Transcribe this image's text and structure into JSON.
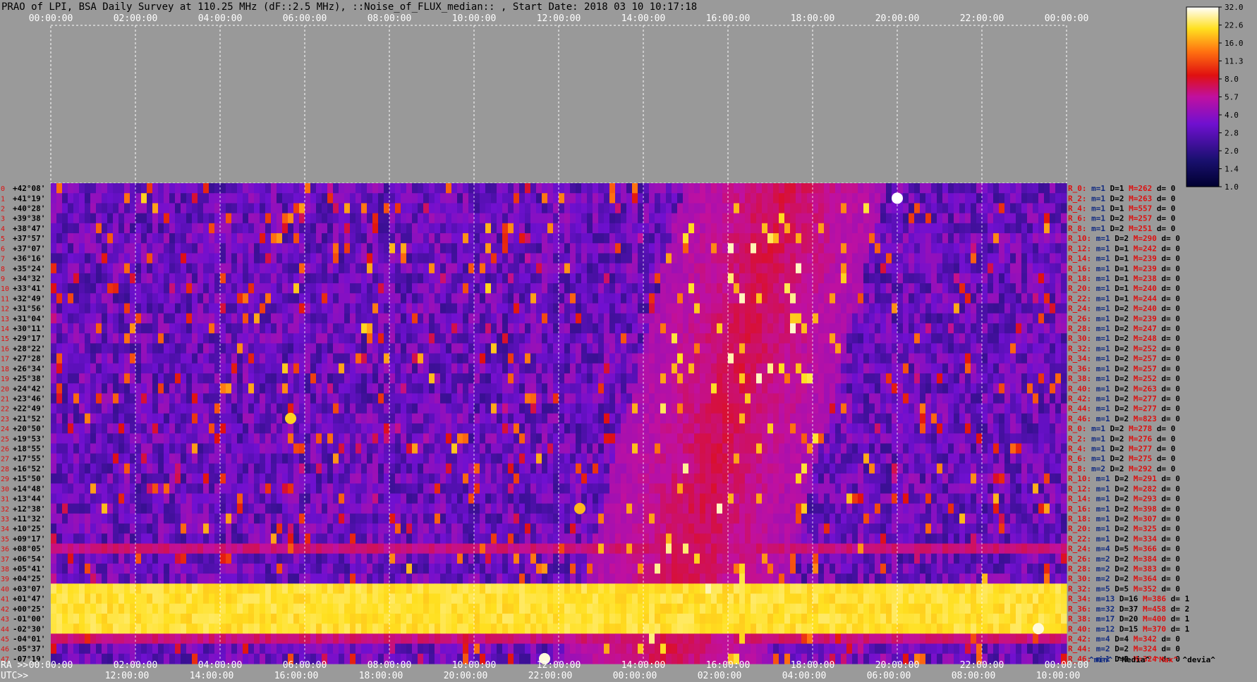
{
  "title": "PRAO of LPI, BSA Daily Survey at 110.25 MHz (dF::2.5 MHz), ::Noise_of_FLUX_median:: , Start Date: 2018 03 10 10:17:18",
  "colors": {
    "background": "#9a9a9a",
    "grid": "#ffffff",
    "label_red": "#dd1111",
    "label_blue": "#102a80",
    "text": "#000000"
  },
  "top_time_ticks": [
    "00:00:00",
    "02:00:00",
    "04:00:00",
    "06:00:00",
    "08:00:00",
    "10:00:00",
    "12:00:00",
    "14:00:00",
    "16:00:00",
    "18:00:00",
    "20:00:00",
    "22:00:00",
    "00:00:00"
  ],
  "ra_axis_label": "RA >>",
  "ra_ticks": [
    "00:00:00",
    "02:00:00",
    "04:00:00",
    "06:00:00",
    "08:00:00",
    "10:00:00",
    "12:00:00",
    "14:00:00",
    "16:00:00",
    "18:00:00",
    "20:00:00",
    "22:00:00",
    "00:00:00"
  ],
  "utc_axis_label": "UTC>>",
  "utc_ticks": [
    "12:00:00",
    "14:00:00",
    "16:00:00",
    "18:00:00",
    "20:00:00",
    "22:00:00",
    "00:00:00",
    "02:00:00",
    "04:00:00",
    "06:00:00",
    "08:00:00",
    "10:00:00"
  ],
  "declinations": [
    "+42°08'",
    "+41°19'",
    "+40°28'",
    "+39°38'",
    "+38°47'",
    "+37°57'",
    "+37°07'",
    "+36°16'",
    "+35°24'",
    "+34°32'",
    "+33°41'",
    "+32°49'",
    "+31°56'",
    "+31°04'",
    "+30°11'",
    "+29°17'",
    "+28°22'",
    "+27°28'",
    "+26°34'",
    "+25°38'",
    "+24°42'",
    "+23°46'",
    "+22°49'",
    "+21°52'",
    "+20°50'",
    "+19°53'",
    "+18°55'",
    "+17°55'",
    "+16°52'",
    "+15°50'",
    "+14°48'",
    "+13°44'",
    "+12°38'",
    "+11°32'",
    "+10°25'",
    "+09°17'",
    "+08°05'",
    "+06°54'",
    "+05°41'",
    "+04°25'",
    "+03°07'",
    "+01°47'",
    "+00°25'",
    "-01°00'",
    "-02°30'",
    "-04°01'",
    "-05°37'",
    "-07°19'"
  ],
  "beam_stats": [
    {
      "r": "R_0:",
      "m": "m=1",
      "d": "D=1",
      "M": "M=262",
      "dv": "d= 0"
    },
    {
      "r": "R_2:",
      "m": "m=1",
      "d": "D=2",
      "M": "M=263",
      "dv": "d= 0"
    },
    {
      "r": "R_4:",
      "m": "m=1",
      "d": "D=1",
      "M": "M=557",
      "dv": "d= 0"
    },
    {
      "r": "R_6:",
      "m": "m=1",
      "d": "D=2",
      "M": "M=257",
      "dv": "d= 0"
    },
    {
      "r": "R_8:",
      "m": "m=1",
      "d": "D=2",
      "M": "M=251",
      "dv": "d= 0"
    },
    {
      "r": "R_10:",
      "m": "m=1",
      "d": "D=2",
      "M": "M=290",
      "dv": "d= 0"
    },
    {
      "r": "R_12:",
      "m": "m=1",
      "d": "D=1",
      "M": "M=242",
      "dv": "d= 0"
    },
    {
      "r": "R_14:",
      "m": "m=1",
      "d": "D=1",
      "M": "M=239",
      "dv": "d= 0"
    },
    {
      "r": "R_16:",
      "m": "m=1",
      "d": "D=1",
      "M": "M=239",
      "dv": "d= 0"
    },
    {
      "r": "R_18:",
      "m": "m=1",
      "d": "D=1",
      "M": "M=238",
      "dv": "d= 0"
    },
    {
      "r": "R_20:",
      "m": "m=1",
      "d": "D=1",
      "M": "M=240",
      "dv": "d= 0"
    },
    {
      "r": "R_22:",
      "m": "m=1",
      "d": "D=1",
      "M": "M=244",
      "dv": "d= 0"
    },
    {
      "r": "R_24:",
      "m": "m=1",
      "d": "D=2",
      "M": "M=240",
      "dv": "d= 0"
    },
    {
      "r": "R_26:",
      "m": "m=1",
      "d": "D=2",
      "M": "M=239",
      "dv": "d= 0"
    },
    {
      "r": "R_28:",
      "m": "m=1",
      "d": "D=2",
      "M": "M=247",
      "dv": "d= 0"
    },
    {
      "r": "R_30:",
      "m": "m=1",
      "d": "D=2",
      "M": "M=248",
      "dv": "d= 0"
    },
    {
      "r": "R_32:",
      "m": "m=1",
      "d": "D=2",
      "M": "M=252",
      "dv": "d= 0"
    },
    {
      "r": "R_34:",
      "m": "m=1",
      "d": "D=2",
      "M": "M=257",
      "dv": "d= 0"
    },
    {
      "r": "R_36:",
      "m": "m=1",
      "d": "D=2",
      "M": "M=257",
      "dv": "d= 0"
    },
    {
      "r": "R_38:",
      "m": "m=1",
      "d": "D=2",
      "M": "M=252",
      "dv": "d= 0"
    },
    {
      "r": "R_40:",
      "m": "m=1",
      "d": "D=2",
      "M": "M=263",
      "dv": "d= 0"
    },
    {
      "r": "R_42:",
      "m": "m=1",
      "d": "D=2",
      "M": "M=277",
      "dv": "d= 0"
    },
    {
      "r": "R_44:",
      "m": "m=1",
      "d": "D=2",
      "M": "M=277",
      "dv": "d= 0"
    },
    {
      "r": "R_46:",
      "m": "m=1",
      "d": "D=2",
      "M": "M=823",
      "dv": "d= 0"
    },
    {
      "r": "R_0:",
      "m": "m=1",
      "d": "D=2",
      "M": "M=278",
      "dv": "d= 0"
    },
    {
      "r": "R_2:",
      "m": "m=1",
      "d": "D=2",
      "M": "M=276",
      "dv": "d= 0"
    },
    {
      "r": "R_4:",
      "m": "m=1",
      "d": "D=2",
      "M": "M=277",
      "dv": "d= 0"
    },
    {
      "r": "R_6:",
      "m": "m=1",
      "d": "D=2",
      "M": "M=275",
      "dv": "d= 0"
    },
    {
      "r": "R_8:",
      "m": "m=2",
      "d": "D=2",
      "M": "M=292",
      "dv": "d= 0"
    },
    {
      "r": "R_10:",
      "m": "m=1",
      "d": "D=2",
      "M": "M=291",
      "dv": "d= 0"
    },
    {
      "r": "R_12:",
      "m": "m=1",
      "d": "D=2",
      "M": "M=282",
      "dv": "d= 0"
    },
    {
      "r": "R_14:",
      "m": "m=1",
      "d": "D=2",
      "M": "M=293",
      "dv": "d= 0"
    },
    {
      "r": "R_16:",
      "m": "m=1",
      "d": "D=2",
      "M": "M=398",
      "dv": "d= 0"
    },
    {
      "r": "R_18:",
      "m": "m=1",
      "d": "D=2",
      "M": "M=307",
      "dv": "d= 0"
    },
    {
      "r": "R_20:",
      "m": "m=1",
      "d": "D=2",
      "M": "M=325",
      "dv": "d= 0"
    },
    {
      "r": "R_22:",
      "m": "m=1",
      "d": "D=2",
      "M": "M=334",
      "dv": "d= 0"
    },
    {
      "r": "R_24:",
      "m": "m=4",
      "d": "D=5",
      "M": "M=366",
      "dv": "d= 0"
    },
    {
      "r": "R_26:",
      "m": "m=2",
      "d": "D=2",
      "M": "M=384",
      "dv": "d= 0"
    },
    {
      "r": "R_28:",
      "m": "m=2",
      "d": "D=2",
      "M": "M=383",
      "dv": "d= 0"
    },
    {
      "r": "R_30:",
      "m": "m=2",
      "d": "D=2",
      "M": "M=364",
      "dv": "d= 0"
    },
    {
      "r": "R_32:",
      "m": "m=5",
      "d": "D=5",
      "M": "M=352",
      "dv": "d= 0"
    },
    {
      "r": "R_34:",
      "m": "m=13",
      "d": "D=16",
      "M": "M=386",
      "dv": "d= 1"
    },
    {
      "r": "R_36:",
      "m": "m=32",
      "d": "D=37",
      "M": "M=458",
      "dv": "d= 2"
    },
    {
      "r": "R_38:",
      "m": "m=17",
      "d": "D=20",
      "M": "M=400",
      "dv": "d= 1"
    },
    {
      "r": "R_40:",
      "m": "m=12",
      "d": "D=15",
      "M": "M=370",
      "dv": "d= 1"
    },
    {
      "r": "R_42:",
      "m": "m=4",
      "d": "D=4",
      "M": "M=342",
      "dv": "d= 0"
    },
    {
      "r": "R_44:",
      "m": "m=2",
      "d": "D=2",
      "M": "M=324",
      "dv": "d= 0"
    },
    {
      "r": "R_46:",
      "m": "m=1",
      "d": "D=2",
      "M": "M=324",
      "dv": "d= 0"
    }
  ],
  "stats_legend": {
    "min": "^min^",
    "media": "^Media^",
    "max": "^Max^",
    "devia": "^devia^"
  },
  "colorbar": {
    "ticks": [
      "32.0",
      "22.6",
      "16.0",
      "11.3",
      "8.0",
      "5.7",
      "4.0",
      "2.8",
      "2.0",
      "1.4",
      "1.0"
    ]
  },
  "chart_data": {
    "type": "heatmap",
    "title": "PRAO of LPI, BSA Daily Survey at 110.25 MHz (dF::2.5 MHz), ::Noise_of_FLUX_median:: , Start Date: 2018 03 10 10:17:18",
    "x_axis": "RA 00:00:00 → 24:00:00",
    "y_axis": "Declination +42°08' → -07°19'",
    "value_range": [
      1.0,
      32.0
    ],
    "scale": "log",
    "color_map": "dark-blue → purple → red → orange → yellow → white",
    "features": [
      {
        "description_label": "bright band",
        "dec_from": "+03°07'",
        "dec_to": "-02°30'",
        "ra_from": "00:00:00",
        "ra_to": "24:00:00",
        "level": 24
      },
      {
        "description_label": "band",
        "dec_from": "+08°05'",
        "dec_to": "+08°05'",
        "ra_from": "00:00:00",
        "ra_to": "24:00:00",
        "level": 7
      },
      {
        "description_label": "band",
        "dec_from": "-04°01'",
        "dec_to": "-04°01'",
        "ra_from": "00:00:00",
        "ra_to": "24:00:00",
        "level": 7
      },
      {
        "description_label": "source",
        "ra": "20:00:00",
        "dec": "+41°19'",
        "level": 32
      },
      {
        "description_label": "source",
        "ra": "05:40:00",
        "dec": "+21°52'",
        "level": 20
      },
      {
        "description_label": "source",
        "ra": "12:30:00",
        "dec": "+12°38'",
        "level": 18
      },
      {
        "description_label": "source",
        "ra": "11:40:00",
        "dec": "-07°19'",
        "level": 30
      },
      {
        "description_label": "source",
        "ra": "23:20:00",
        "dec": "-02°30'",
        "level": 30
      }
    ]
  }
}
